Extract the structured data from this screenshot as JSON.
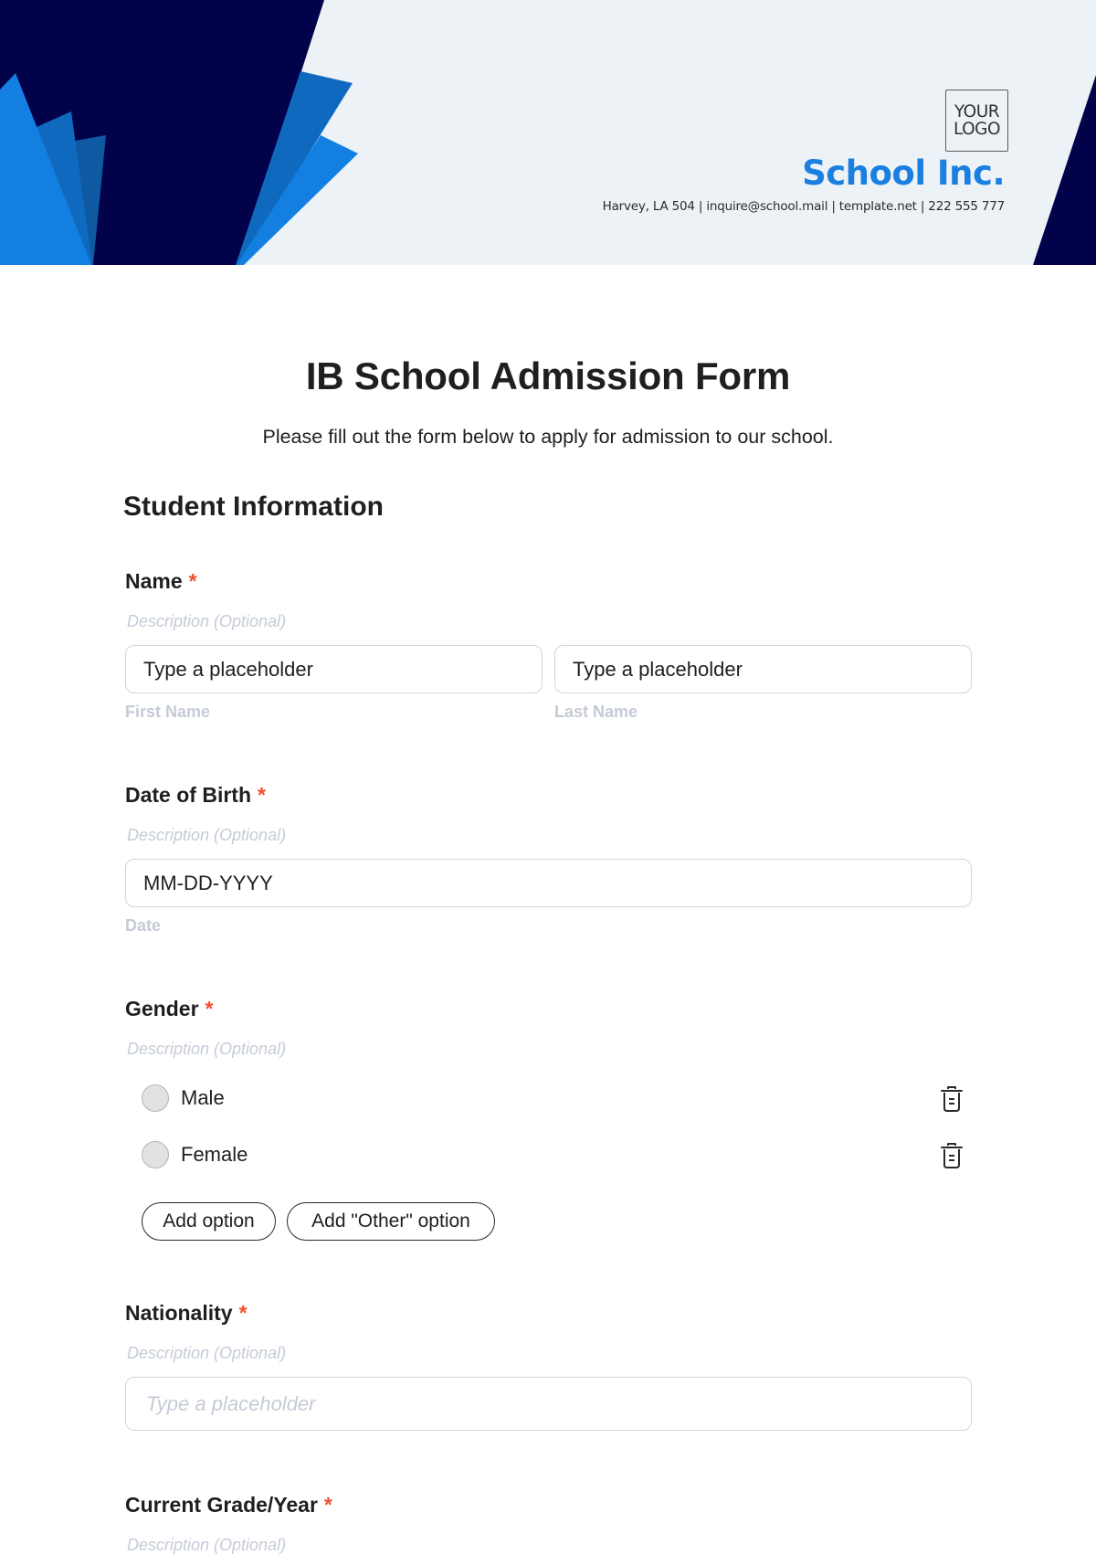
{
  "header": {
    "logo_line1": "YOUR",
    "logo_line2": "LOGO",
    "company_name": "School Inc.",
    "company_info": "Harvey, LA 504 | inquire@school.mail | template.net | 222 555 777",
    "colors": {
      "navy": "#02024a",
      "blue_bright": "#137fe1",
      "blue_mid": "#0f6abf",
      "blue_dark": "#0f58a2",
      "background": "#edf2f7",
      "brand": "#1a7fe0"
    }
  },
  "form": {
    "title": "IB School Admission Form",
    "subtitle": "Please fill out the form below to apply for admission to our school.",
    "section_title": "Student Information",
    "required_mark": "*",
    "fields": {
      "name": {
        "label": "Name",
        "description": "Description (Optional)",
        "first_value": "Type a placeholder",
        "first_sublabel": "First Name",
        "last_value": "Type a placeholder",
        "last_sublabel": "Last Name"
      },
      "dob": {
        "label": "Date of Birth",
        "description": "Description (Optional)",
        "value": "MM-DD-YYYY",
        "sublabel": "Date"
      },
      "gender": {
        "label": "Gender",
        "description": "Description (Optional)",
        "options": [
          "Male",
          "Female"
        ],
        "add_option_label": "Add option",
        "add_other_label": "Add \"Other\" option"
      },
      "nationality": {
        "label": "Nationality",
        "description": "Description (Optional)",
        "placeholder": "Type a placeholder"
      },
      "grade": {
        "label": "Current Grade/Year",
        "description": "Description (Optional)"
      }
    }
  }
}
